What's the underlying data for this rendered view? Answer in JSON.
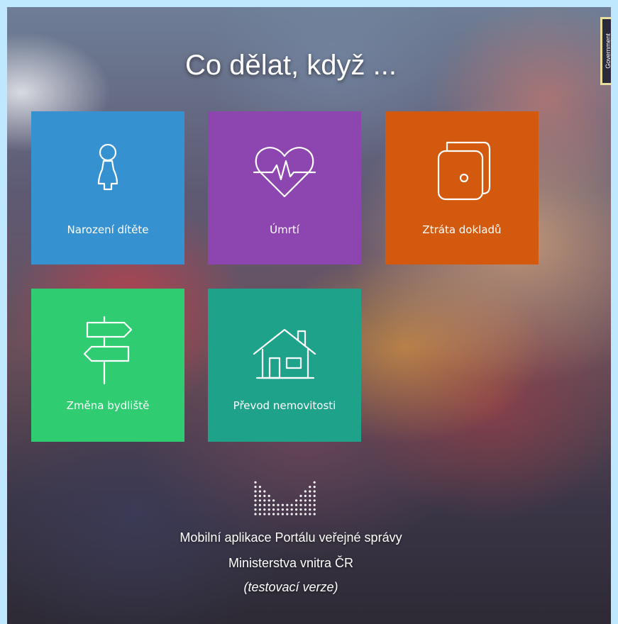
{
  "page": {
    "title": "Co dělat, když ..."
  },
  "badge": {
    "text": "Government"
  },
  "tiles": [
    {
      "label": "Narození dítěte",
      "icon": "child-icon",
      "color": "#3591cf"
    },
    {
      "label": "Úmrtí",
      "icon": "heartbeat-icon",
      "color": "#8d45b0"
    },
    {
      "label": "Ztráta dokladů",
      "icon": "wallet-icon",
      "color": "#d3590e"
    },
    {
      "label": "Změna bydliště",
      "icon": "signpost-icon",
      "color": "#2fcc72"
    },
    {
      "label": "Převod nemovitosti",
      "icon": "house-icon",
      "color": "#1fa28a"
    }
  ],
  "footer": {
    "logo_icon": "portal-logo-icon",
    "line1": "Mobilní aplikace Portálu veřejné správy",
    "line2": "Ministerstva vnitra ČR",
    "line3": "(testovací verze)"
  }
}
